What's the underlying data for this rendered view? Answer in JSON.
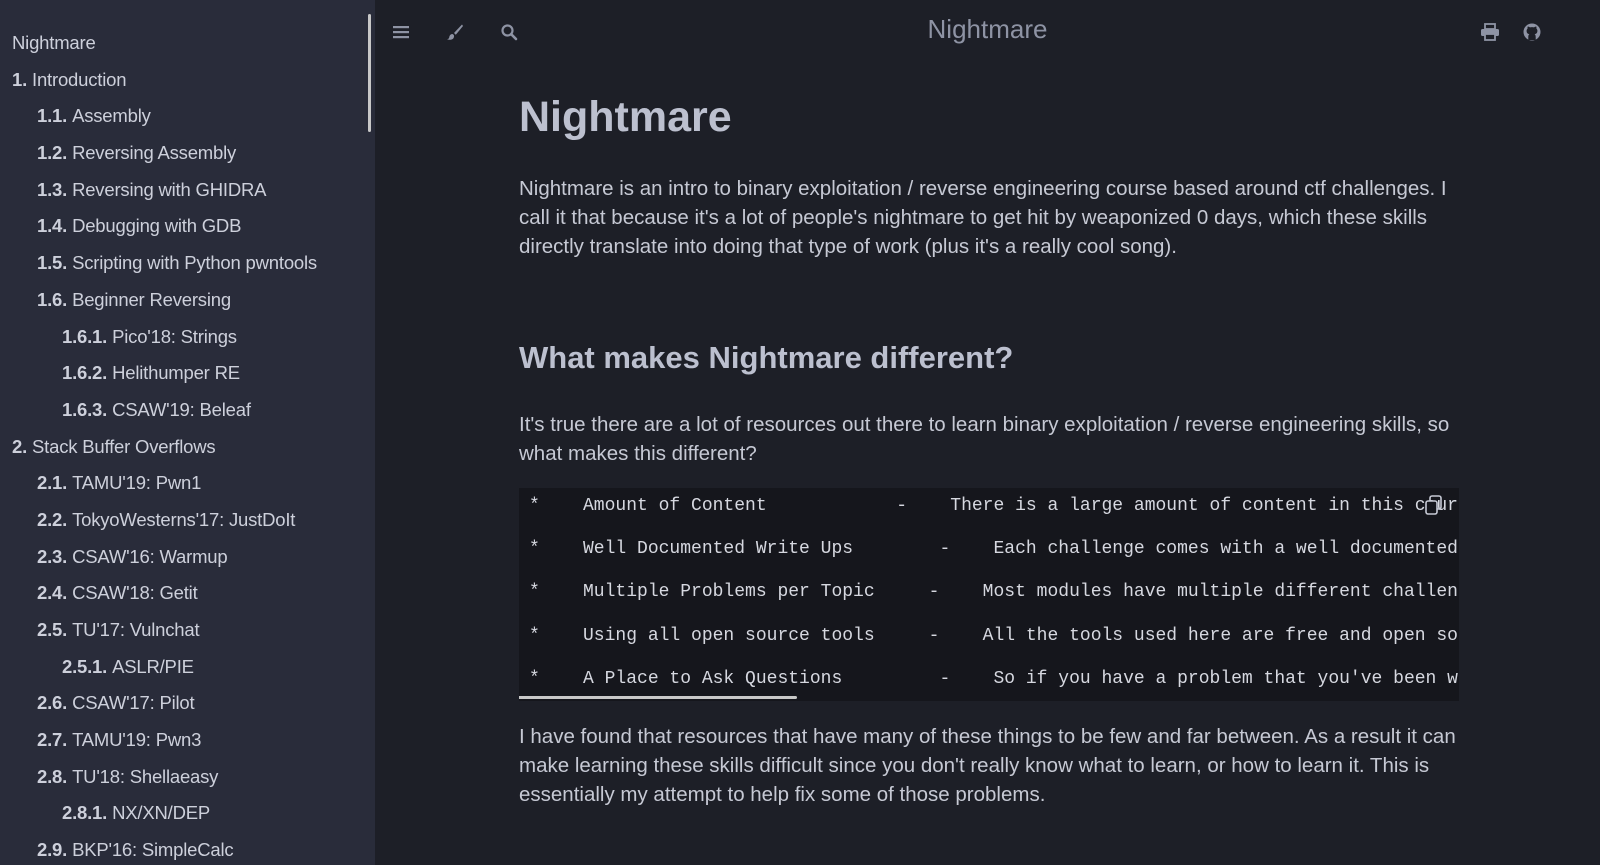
{
  "sidebar": {
    "items": [
      {
        "num": "",
        "label": "Nightmare",
        "level": 0
      },
      {
        "num": "1.",
        "label": "Introduction",
        "level": 0
      },
      {
        "num": "1.1.",
        "label": "Assembly",
        "level": 1
      },
      {
        "num": "1.2.",
        "label": "Reversing Assembly",
        "level": 1
      },
      {
        "num": "1.3.",
        "label": "Reversing with GHIDRA",
        "level": 1
      },
      {
        "num": "1.4.",
        "label": "Debugging with GDB",
        "level": 1
      },
      {
        "num": "1.5.",
        "label": "Scripting with Python pwntools",
        "level": 1
      },
      {
        "num": "1.6.",
        "label": "Beginner Reversing",
        "level": 1
      },
      {
        "num": "1.6.1.",
        "label": "Pico'18: Strings",
        "level": 2
      },
      {
        "num": "1.6.2.",
        "label": "Helithumper RE",
        "level": 2
      },
      {
        "num": "1.6.3.",
        "label": "CSAW'19: Beleaf",
        "level": 2
      },
      {
        "num": "2.",
        "label": "Stack Buffer Overflows",
        "level": 0
      },
      {
        "num": "2.1.",
        "label": "TAMU'19: Pwn1",
        "level": 1
      },
      {
        "num": "2.2.",
        "label": "TokyoWesterns'17: JustDoIt",
        "level": 1
      },
      {
        "num": "2.3.",
        "label": "CSAW'16: Warmup",
        "level": 1
      },
      {
        "num": "2.4.",
        "label": "CSAW'18: Getit",
        "level": 1
      },
      {
        "num": "2.5.",
        "label": "TU'17: Vulnchat",
        "level": 1
      },
      {
        "num": "2.5.1.",
        "label": "ASLR/PIE",
        "level": 2
      },
      {
        "num": "2.6.",
        "label": "CSAW'17: Pilot",
        "level": 1
      },
      {
        "num": "2.7.",
        "label": "TAMU'19: Pwn3",
        "level": 1
      },
      {
        "num": "2.8.",
        "label": "TU'18: Shellaeasy",
        "level": 1
      },
      {
        "num": "2.8.1.",
        "label": "NX/XN/DEP",
        "level": 2
      },
      {
        "num": "2.9.",
        "label": "BKP'16: SimpleCalc",
        "level": 1
      }
    ]
  },
  "menubar": {
    "title": "Nightmare",
    "left_icons": [
      "hamburger-menu-icon",
      "paintbrush-icon",
      "search-icon"
    ],
    "right_icons": [
      "printer-icon",
      "github-icon"
    ]
  },
  "page": {
    "title": "Nightmare",
    "intro": "Nightmare is an intro to binary exploitation / reverse engineering course based around ctf challenges. I call it that because it's a lot of people's nightmare to get hit by weaponized 0 days, which these skills directly translate into doing that type of work (plus it's a really cool song).",
    "section_heading": "What makes Nightmare different?",
    "section_intro": "It's true there are a lot of resources out there to learn binary exploitation / reverse engineering skills, so what makes this different?",
    "code_lines": [
      "*    Amount of Content            -    There is a large amount of content in this course",
      "*    Well Documented Write Ups        -    Each challenge comes with a well documented write up",
      "*    Multiple Problems per Topic     -    Most modules have multiple different challenges",
      "*    Using all open source tools     -    All the tools used here are free and open source",
      "*    A Place to Ask Questions         -    So if you have a problem that you've been working on"
    ],
    "closing": "I have found that resources that have many of these things to be few and far between. As a result it can make learning these skills difficult since you don't really know what to learn, or how to learn it. This is essentially my attempt to help fix some of those problems."
  },
  "colors": {
    "sidebar_bg": "#292c3a",
    "main_bg": "#1d1f27",
    "code_bg": "#15161c"
  }
}
